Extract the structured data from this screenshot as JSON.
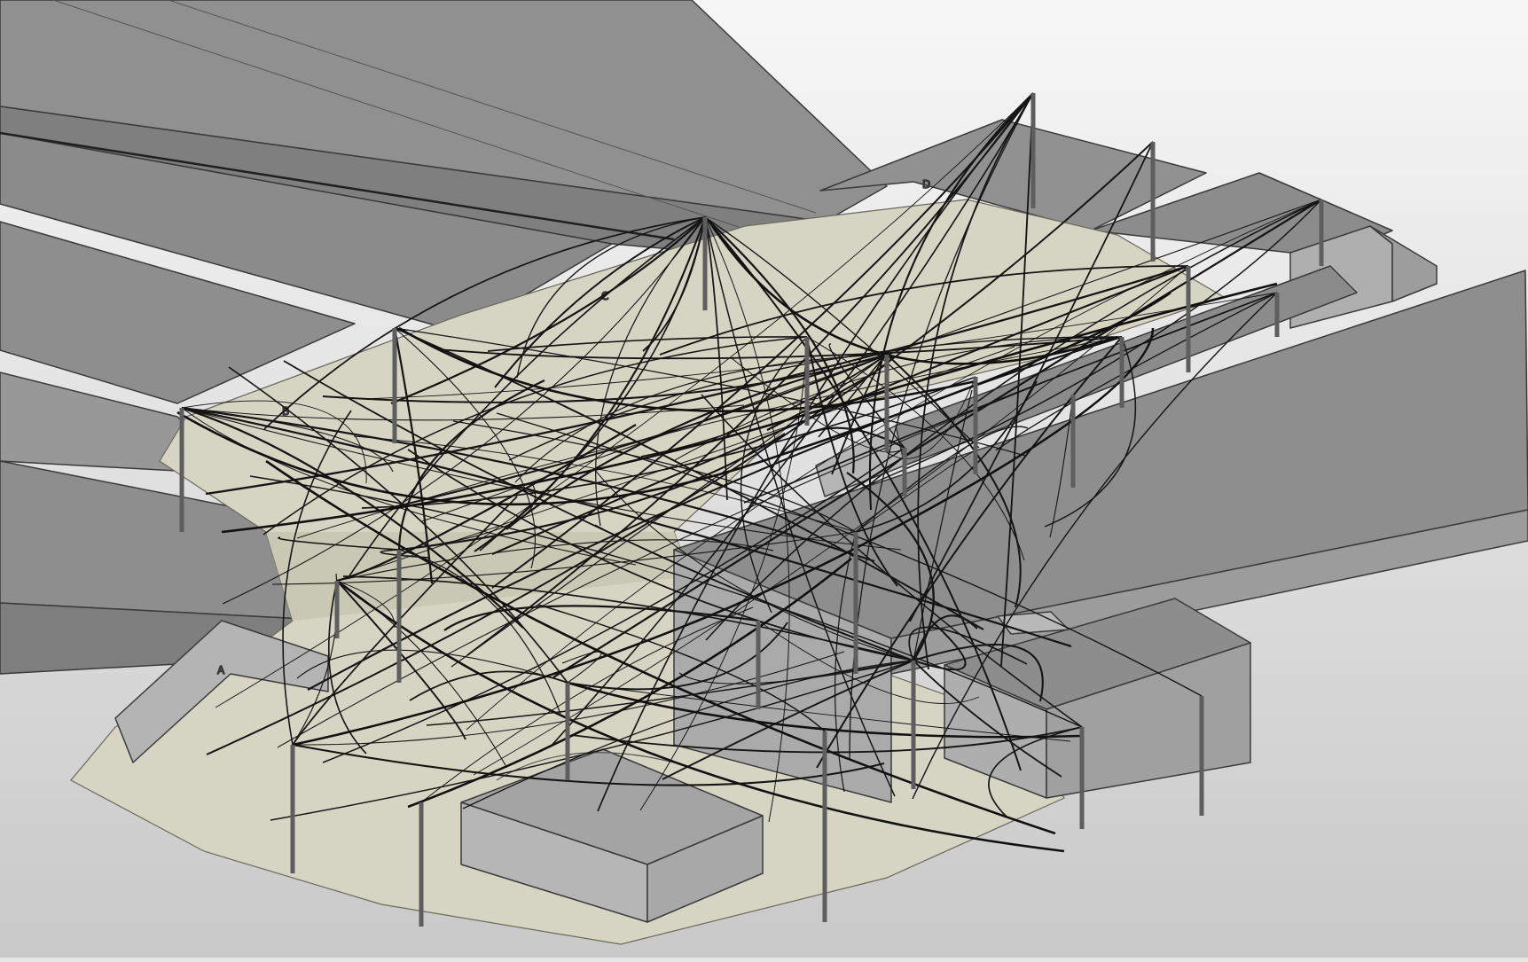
{
  "model": {
    "zone_labels": [
      "A",
      "B",
      "C",
      "D"
    ]
  },
  "colors": {
    "background_top": "#f7f7f7",
    "background_bottom": "#c9c9c9",
    "roof": "#8d8e8d",
    "roof_dark": "#7e7f7e",
    "wall": "#a8a9a8",
    "wall_light": "#bcbdbc",
    "ground": "#d5d4c4",
    "ground_dark": "#c6c5b2",
    "line": "#151515",
    "mast": "#6b6b6b"
  }
}
